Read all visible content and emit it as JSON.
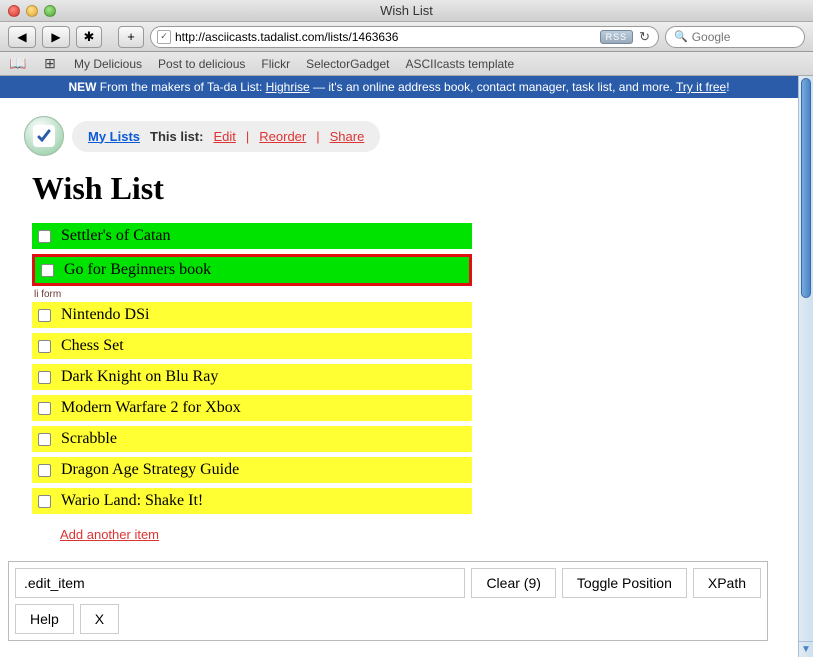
{
  "window": {
    "title": "Wish List"
  },
  "toolbar": {
    "url": "http://asciicasts.tadalist.com/lists/1463636",
    "rss_label": "RSS",
    "search_placeholder": "Google"
  },
  "bookmarks": [
    "My Delicious",
    "Post to delicious",
    "Flickr",
    "SelectorGadget",
    "ASCIIcasts template"
  ],
  "promo": {
    "new": "NEW",
    "lead": "From the makers of Ta-da List:",
    "product": "Highrise",
    "mid": "— it's an online address book, contact manager, task list, and more.",
    "cta": "Try it free"
  },
  "pill": {
    "mylists": "My Lists",
    "thislist": "This list:",
    "edit": "Edit",
    "reorder": "Reorder",
    "share": "Share"
  },
  "page_title": "Wish List",
  "items": [
    {
      "label": "Settler's of Catan",
      "state": "g"
    },
    {
      "label": "Go for Beginners book",
      "state": "sel"
    },
    {
      "label": "Nintendo DSi",
      "state": "y"
    },
    {
      "label": "Chess Set",
      "state": "y"
    },
    {
      "label": "Dark Knight on Blu Ray",
      "state": "y"
    },
    {
      "label": "Modern Warfare 2 for Xbox",
      "state": "y"
    },
    {
      "label": "Scrabble",
      "state": "y"
    },
    {
      "label": "Dragon Age Strategy Guide",
      "state": "y"
    },
    {
      "label": "Wario Land: Shake It!",
      "state": "y"
    }
  ],
  "form_tag": "li form",
  "add_link": "Add another item",
  "selectorgadget": {
    "selector": ".edit_item",
    "clear": "Clear (9)",
    "toggle": "Toggle Position",
    "xpath": "XPath",
    "help": "Help",
    "close": "X"
  }
}
